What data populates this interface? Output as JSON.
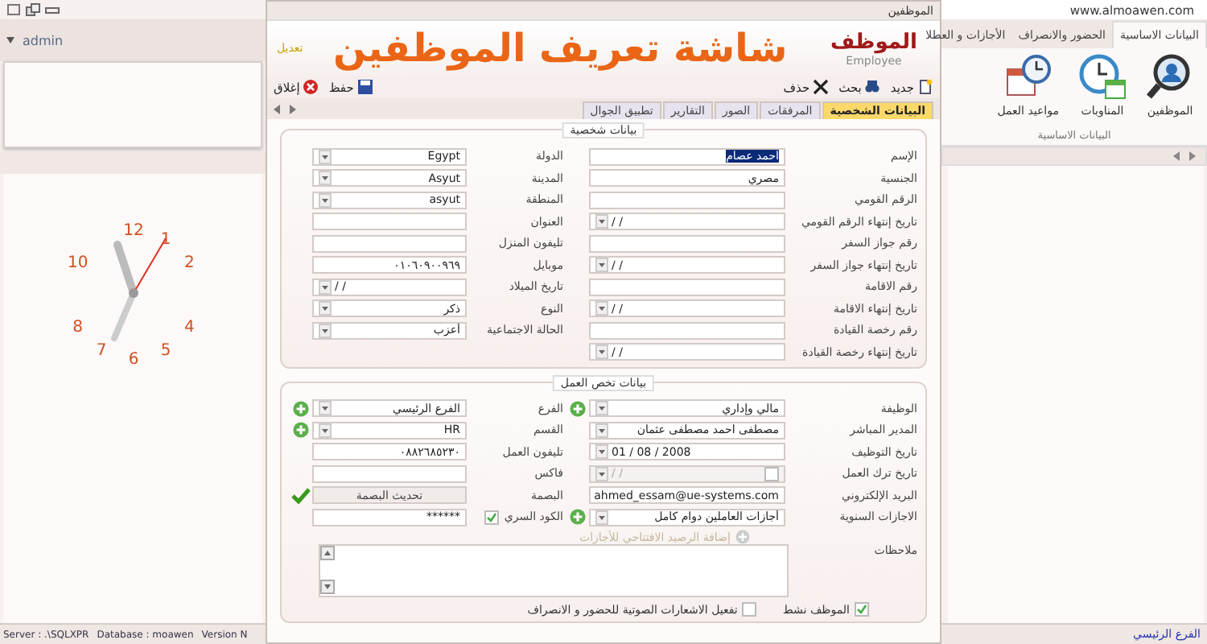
{
  "left_panel": {
    "user": "admin",
    "clock": {
      "numbers": [
        "12",
        "1",
        "10",
        "2",
        "8",
        "4",
        "7",
        "6",
        "5"
      ]
    }
  },
  "form_window": {
    "title": "الموظفين",
    "header": {
      "title": "الموظف",
      "subtitle": "Employee",
      "mode": "تعديل",
      "headline": "شاشة تعريف الموظفين"
    },
    "toolbar_right": [
      {
        "label": "جديد"
      },
      {
        "label": "بحث"
      },
      {
        "label": "حذف"
      }
    ],
    "toolbar_left": [
      {
        "label": "حفظ"
      },
      {
        "label": "إغلاق"
      }
    ],
    "tabs": [
      {
        "label": "البيانات الشخصية",
        "selected": true
      },
      {
        "label": "المرفقات",
        "selected": false
      },
      {
        "label": "الصور",
        "selected": false
      },
      {
        "label": "التقارير",
        "selected": false
      },
      {
        "label": "تطبيق الجوال",
        "selected": false
      }
    ],
    "personal": {
      "title": "بيانات شخصية",
      "columns": [
        [
          {
            "label": "الإسم",
            "kind": "text",
            "value": "احمد عصام",
            "highlighted": true
          },
          {
            "label": "الجنسية",
            "kind": "text",
            "value": "مصري"
          },
          {
            "label": "الرقم القومي",
            "kind": "text"
          },
          {
            "label": "تاريخ إنتهاء الرقم القومي",
            "kind": "date",
            "value": "/   /"
          },
          {
            "label": "رقم جواز السفر",
            "kind": "text"
          },
          {
            "label": "تاريخ إنتهاء جواز السفر",
            "kind": "date",
            "value": "/   /"
          },
          {
            "label": "رقم الاقامة",
            "kind": "text"
          },
          {
            "label": "تاريخ إنتهاء الاقامة",
            "kind": "date",
            "value": "/   /"
          },
          {
            "label": "رقم رخصة القيادة",
            "kind": "text"
          },
          {
            "label": "تاريخ إنتهاء رخصة القيادة",
            "kind": "date",
            "value": "/   /"
          }
        ],
        [
          {
            "label": "الدولة",
            "kind": "combo",
            "value": "Egypt"
          },
          {
            "label": "المدينة",
            "kind": "combo",
            "value": "Asyut"
          },
          {
            "label": "المنطقة",
            "kind": "combo",
            "value": "asyut"
          },
          {
            "label": "العنوان",
            "kind": "text"
          },
          {
            "label": "تليفون المنزل",
            "kind": "text"
          },
          {
            "label": "موبايل",
            "kind": "text",
            "value": "٠١٠٦٠٩٠٠٩٦٩"
          },
          {
            "label": "تاريخ الميلاد",
            "kind": "date",
            "value": "/   /"
          },
          {
            "label": "النوع",
            "kind": "combo",
            "value": "ذكر"
          },
          {
            "label": "الحالة الاجتماعية",
            "kind": "combo",
            "value": "أعزب"
          }
        ]
      ]
    },
    "work": {
      "title": "بيانات تخص العمل",
      "columns": [
        [
          {
            "label": "الوظيفة",
            "kind": "combo",
            "value": "مالي وإداري",
            "add": true
          },
          {
            "label": "المدير المباشر",
            "kind": "combo",
            "value": "مصطفى احمد مصطفى عثمان"
          },
          {
            "label": "تاريخ التوظيف",
            "kind": "date",
            "value": "01 / 08 / 2008"
          },
          {
            "label": "تاريخ ترك العمل",
            "kind": "date",
            "value": "/   /",
            "disabled": true
          },
          {
            "label": "البريد الإلكتروني",
            "kind": "text",
            "value": "ahmed_essam@ue-systems.com"
          },
          {
            "label": "الاجازات السنوية",
            "kind": "combo",
            "value": "أجازات العاملين دوام كامل",
            "add": true
          }
        ],
        [
          {
            "label": "الفرع",
            "kind": "combo",
            "value": "الفرع الرئيسي",
            "add": true
          },
          {
            "label": "القسم",
            "kind": "combo",
            "value": "HR",
            "add": true
          },
          {
            "label": "تليفون العمل",
            "kind": "text",
            "value": "٠٨٨٢٦٨٥٢٣٠"
          },
          {
            "label": "فاكس",
            "kind": "text"
          },
          {
            "label": "البصمة",
            "kind": "button",
            "value": "تحديث البصمة",
            "verified": true
          },
          {
            "label": "الكود السري",
            "kind": "secret",
            "value": "******",
            "checked": true
          }
        ]
      ],
      "opening_balance": {
        "label": "إضافة الرصيد الافتتاحي للأجازات",
        "disabled": true
      },
      "notes_label": "ملاحظات",
      "checks": [
        {
          "label": "الموظف نشط",
          "checked": true
        },
        {
          "label": "تفعيل الاشعارات الصوتية للحضور و الانصراف",
          "checked": false
        }
      ]
    }
  },
  "ribbon": {
    "site": "www.almoawen.com",
    "tabs": [
      {
        "label": "البيانات الاساسية",
        "selected": true
      },
      {
        "label": "الحضور والانصراف",
        "selected": false
      },
      {
        "label": "الأجازات و العطلا",
        "selected": false
      }
    ],
    "buttons": [
      {
        "label": "الموظفين"
      },
      {
        "label": "المناوبات"
      },
      {
        "label": "مواعيد العمل"
      }
    ],
    "group": "البيانات الاساسية"
  },
  "status_bar": {
    "server": "Server :  .\\SQLXPR",
    "database": "Database :  moawen",
    "version": "Version N",
    "branch": "الفرع الرئيسي"
  }
}
